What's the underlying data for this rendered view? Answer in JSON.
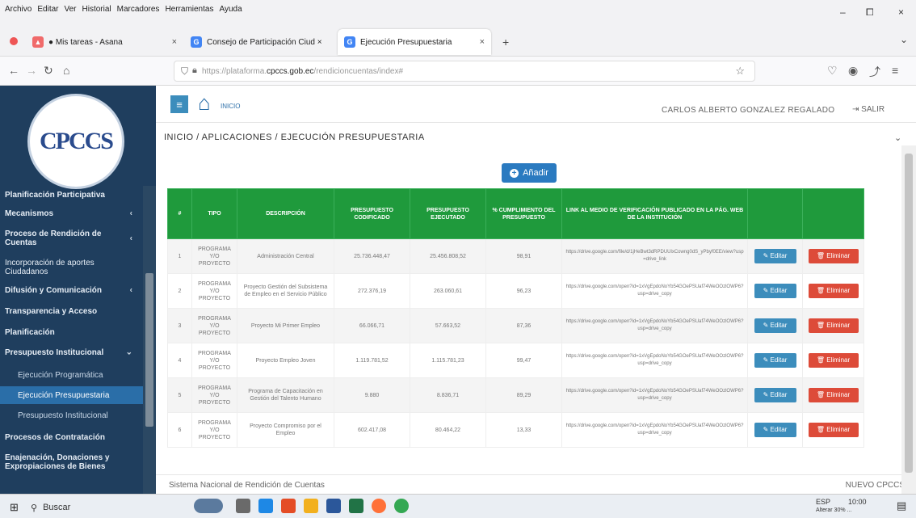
{
  "window": {
    "menus": [
      "Archivo",
      "Editar",
      "Ver",
      "Historial",
      "Marcadores",
      "Herramientas",
      "Ayuda"
    ],
    "minimize": "–",
    "maximize": "⧠",
    "close": "×"
  },
  "tabs": [
    {
      "label": "● Mis tareas - Asana",
      "icon": "asana-icon",
      "close": "×"
    },
    {
      "label": "Consejo de Participación Ciud ×",
      "icon": "google-icon",
      "close": ""
    },
    {
      "label": "Ejecución Presupuestaria",
      "icon": "google-icon",
      "close": "×"
    }
  ],
  "new_tab": "+",
  "tab_list": "⌄",
  "nav": {
    "url_host": "https://plataforma.",
    "url_domain": "cpccs.gob.ec",
    "url_path": "/rendicioncuentas/index#"
  },
  "sidebar": {
    "logo_text": "CPCCS",
    "items": [
      {
        "label": "Planificación Participativa",
        "type": "strong",
        "chev": ""
      },
      {
        "label": "Mecanismos",
        "type": "strong",
        "chev": "‹"
      },
      {
        "label": "Proceso de Rendición de Cuentas",
        "type": "strong",
        "chev": "‹"
      },
      {
        "label": "Incorporación de aportes Ciudadanos",
        "type": "normal",
        "chev": ""
      },
      {
        "label": "Difusión y Comunicación",
        "type": "strong",
        "chev": "‹"
      },
      {
        "label": "Transparencia y Acceso",
        "type": "strong",
        "chev": ""
      },
      {
        "label": "Planificación",
        "type": "strong",
        "chev": ""
      },
      {
        "label": "Presupuesto Institucional",
        "type": "strong",
        "chev": "⌄"
      },
      {
        "label": "Ejecución Programática",
        "type": "sub",
        "chev": ""
      },
      {
        "label": "Ejecución Presupuestaria",
        "type": "sub active",
        "chev": ""
      },
      {
        "label": "Presupuesto Institucional",
        "type": "sub",
        "chev": ""
      },
      {
        "label": "Procesos de Contratación",
        "type": "strong",
        "chev": ""
      },
      {
        "label": "Enajenación, Donaciones y Expropiaciones de Bienes",
        "type": "strong",
        "chev": ""
      }
    ]
  },
  "header": {
    "home_label": "INICIO",
    "user": "CARLOS ALBERTO GONZALEZ REGALADO",
    "logout": "SALIR"
  },
  "breadcrumb": "INICIO / APLICACIONES / EJECUCIÓN PRESUPUESTARIA",
  "add_button": "Añadir",
  "table": {
    "headers": [
      "#",
      "TIPO",
      "DESCRIPCIÓN",
      "PRESUPUESTO CODIFICADO",
      "PRESUPUESTO EJECUTADO",
      "% CUMPLIMIENTO DEL PRESUPUESTO",
      "LINK AL MEDIO DE VERIFICACIÓN PUBLICADO EN LA PÁG. WEB DE LA INSTITUCIÓN",
      "",
      ""
    ],
    "rows": [
      {
        "n": "1",
        "tipo": "PROGRAMA Y/O PROYECTO",
        "desc": "Administración Central",
        "cod": "25.736.448,47",
        "eje": "25.456.808,52",
        "pct": "98,91",
        "link": "https://drive.google.com/file/d/1jHeBwt3dRPDUUlxCowng0dS_yPbyf0EE/view?usp=drive_link"
      },
      {
        "n": "2",
        "tipo": "PROGRAMA Y/O PROYECTO",
        "desc": "Proyecto Gestión del Subsistema de Empleo en el Servicio Público",
        "cod": "272.376,19",
        "eje": "263.060,61",
        "pct": "96,23",
        "link": "https://drive.google.com/open?id=1xVgEpdoNoYb54GOePSUaf74WeOOzlOWP6?usp=drive_copy"
      },
      {
        "n": "3",
        "tipo": "PROGRAMA Y/O PROYECTO",
        "desc": "Proyecto Mi Primer Empleo",
        "cod": "66.066,71",
        "eje": "57.663,52",
        "pct": "87,36",
        "link": "https://drive.google.com/open?id=1xVgEpdoNoYb54GOePSUaf74WeOOzlOWP6?usp=drive_copy"
      },
      {
        "n": "4",
        "tipo": "PROGRAMA Y/O PROYECTO",
        "desc": "Proyecto Empleo Joven",
        "cod": "1.119.781,52",
        "eje": "1.115.781,23",
        "pct": "99,47",
        "link": "https://drive.google.com/open?id=1xVgEpdoNoYb54GOePSUaf74WeOOzlOWP6?usp=drive_copy"
      },
      {
        "n": "5",
        "tipo": "PROGRAMA Y/O PROYECTO",
        "desc": "Programa de Capacitación en Gestión del Talento Humano",
        "cod": "9.880",
        "eje": "8.836,71",
        "pct": "89,29",
        "link": "https://drive.google.com/open?id=1xVgEpdoNoYb54GOePSUaf74WeOOzlOWP6?usp=drive_copy"
      },
      {
        "n": "6",
        "tipo": "PROGRAMA Y/O PROYECTO",
        "desc": "Proyecto Compromiso por el Empleo",
        "cod": "602.417,08",
        "eje": "80.464,22",
        "pct": "13,33",
        "link": "https://drive.google.com/open?id=1xVgEpdoNoYb54GOePSUaf74WeOOzlOWP6?usp=drive_copy"
      }
    ],
    "edit_label": "Editar",
    "delete_label": "Eliminar"
  },
  "footer": {
    "left": "Sistema Nacional de Rendición de Cuentas",
    "right": "NUEVO CPCCS"
  },
  "taskbar": {
    "search": "Buscar",
    "time": "10:00",
    "lang": "ESP",
    "date": "Alterar 30% ..."
  },
  "colors": {
    "sidebar": "#1f3e5e",
    "table_header": "#1f9a3c",
    "accent": "#2a7ac0",
    "danger": "#dd4b39"
  }
}
